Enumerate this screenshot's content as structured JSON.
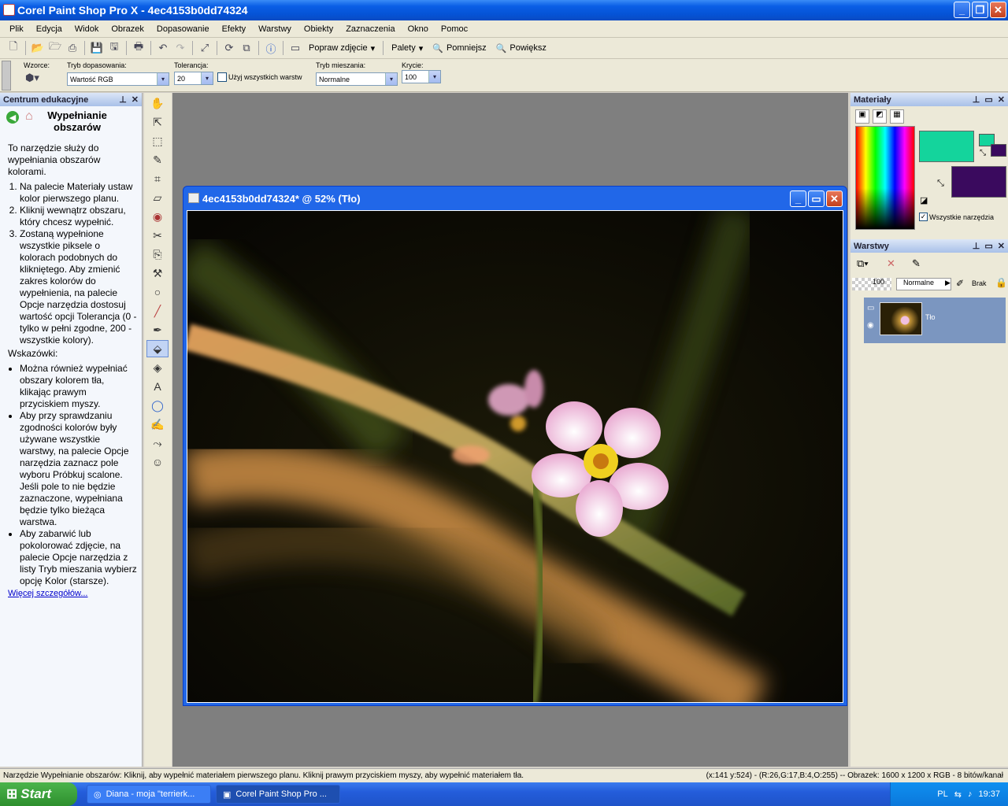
{
  "window": {
    "title": "Corel Paint Shop Pro X - 4ec4153b0dd74324"
  },
  "menu": [
    "Plik",
    "Edycja",
    "Widok",
    "Obrazek",
    "Dopasowanie",
    "Efekty",
    "Warstwy",
    "Obiekty",
    "Zaznaczenia",
    "Okno",
    "Pomoc"
  ],
  "toolbar": {
    "popraw": "Popraw zdjęcie",
    "palety": "Palety",
    "pomniejsz": "Pomniejsz",
    "powieksz": "Powiększ"
  },
  "options": {
    "wzorce_label": "Wzorce:",
    "tryb_dop_label": "Tryb dopasowania:",
    "tryb_dop_value": "Wartość RGB",
    "tolerancja_label": "Tolerancja:",
    "tolerancja_value": "20",
    "all_layers_label": "Użyj wszystkich warstw",
    "tryb_miesz_label": "Tryb mieszania:",
    "tryb_miesz_value": "Normalne",
    "krycie_label": "Krycie:",
    "krycie_value": "100"
  },
  "learn": {
    "header": "Centrum edukacyjne",
    "title": "Wypełnianie obszarów",
    "intro": "To narzędzie służy do wypełniania obszarów kolorami.",
    "steps": [
      "Na palecie Materiały ustaw kolor pierwszego planu.",
      "Kliknij wewnątrz obszaru, który chcesz wypełnić.",
      "Zostaną wypełnione wszystkie piksele o kolorach podobnych do klikniętego. Aby zmienić zakres kolorów do wypełnienia, na palecie Opcje narzędzia dostosuj wartość opcji Tolerancja (0 - tylko w pełni zgodne, 200 - wszystkie kolory)."
    ],
    "tips_label": "Wskazówki:",
    "tips": [
      "Można również wypełniać obszary kolorem tła, klikając prawym przyciskiem myszy.",
      "Aby przy sprawdzaniu zgodności kolorów były używane wszystkie warstwy, na palecie Opcje narzędzia zaznacz pole wyboru Próbkuj scalone. Jeśli pole to nie będzie zaznaczone, wypełniana będzie tylko bieżąca warstwa.",
      "Aby zabarwić lub pokolorować zdjęcie, na palecie Opcje narzędzia z listy Tryb mieszania wybierz opcję Kolor (starsze)."
    ],
    "more": "Więcej szczegółów..."
  },
  "document": {
    "title": "4ec4153b0dd74324* @  52% (Tło)"
  },
  "materials": {
    "header": "Materiały",
    "all_tools": "Wszystkie narzędzia",
    "fg_color": "#14d49c",
    "bg_color": "#3a0a5e"
  },
  "layers": {
    "header": "Warstwy",
    "opacity": "100",
    "blend": "Normalne",
    "mask": "Brak",
    "layer_name": "Tło"
  },
  "status": {
    "left": "Narzędzie Wypełnianie obszarów: Kliknij, aby wypełnić materiałem pierwszego planu. Kliknij prawym przyciskiem myszy, aby wypełnić materiałem tła.",
    "right": "(x:141 y:524) - (R:26,G:17,B:4,O:255) -- Obrazek:  1600 x 1200 x RGB - 8 bitów/kanał"
  },
  "taskbar": {
    "start": "Start",
    "task1": "Diana - moja \"terrierk...",
    "task2": "Corel Paint Shop Pro ...",
    "lang": "PL",
    "time": "19:37"
  }
}
